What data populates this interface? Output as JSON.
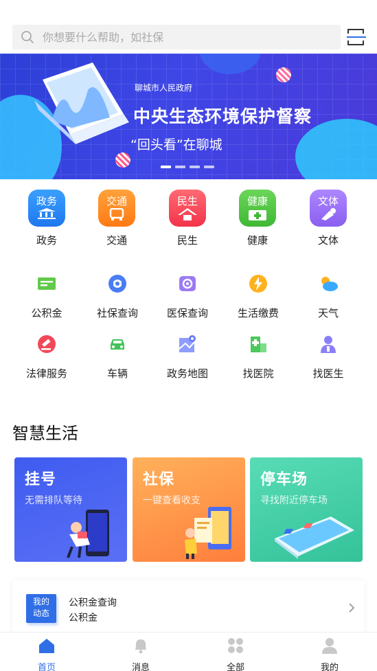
{
  "search": {
    "placeholder": "你想要什么帮助，如社保"
  },
  "banner": {
    "org": "聊城市人民政府",
    "title": "中央生态环境保护督察",
    "subtitle": "“回头看”在聊城",
    "active_dot": 1,
    "dot_count": 4
  },
  "categories": [
    {
      "label": "政务",
      "icon_text": "政务",
      "icon": "government-building-icon",
      "color": "#2d8df5"
    },
    {
      "label": "交通",
      "icon_text": "交通",
      "icon": "bus-icon",
      "color": "#ff8a1f"
    },
    {
      "label": "民生",
      "icon_text": "民生",
      "icon": "house-icon",
      "color": "#f5475a"
    },
    {
      "label": "健康",
      "icon_text": "健康",
      "icon": "medical-kit-icon",
      "color": "#56c94a"
    },
    {
      "label": "文体",
      "icon_text": "文体",
      "icon": "sports-icon",
      "color": "#9b6ff4"
    }
  ],
  "services_row1": [
    {
      "label": "公积金",
      "icon": "fund-card-icon"
    },
    {
      "label": "社保查询",
      "icon": "social-security-icon"
    },
    {
      "label": "医保查询",
      "icon": "medical-insurance-icon"
    },
    {
      "label": "生活缴费",
      "icon": "utility-payment-icon"
    },
    {
      "label": "天气",
      "icon": "weather-icon"
    }
  ],
  "services_row2": [
    {
      "label": "法律服务",
      "icon": "gavel-icon"
    },
    {
      "label": "车辆",
      "icon": "car-icon"
    },
    {
      "label": "政务地图",
      "icon": "map-icon"
    },
    {
      "label": "找医院",
      "icon": "hospital-icon"
    },
    {
      "label": "找医生",
      "icon": "doctor-icon"
    }
  ],
  "smart_life": {
    "title": "智慧生活",
    "cards": [
      {
        "title": "挂号",
        "subtitle": "无需排队等待",
        "color_from": "#3f5cf0",
        "color_to": "#5a6ff5"
      },
      {
        "title": "社保",
        "subtitle": "一键查看收支",
        "color_from": "#ffb15a",
        "color_to": "#ff7e3c"
      },
      {
        "title": "停车场",
        "subtitle": "寻找附近停车场",
        "color_from": "#4fd6b0",
        "color_to": "#37c49a"
      }
    ]
  },
  "news": {
    "badge_line1": "我的",
    "badge_line2": "动态",
    "line1": "公积金查询",
    "line2": "公积金"
  },
  "tabbar": [
    {
      "label": "首页",
      "icon": "home-icon",
      "active": true
    },
    {
      "label": "消息",
      "icon": "bell-icon",
      "active": false
    },
    {
      "label": "全部",
      "icon": "grid-icon",
      "active": false
    },
    {
      "label": "我的",
      "icon": "user-icon",
      "active": false
    }
  ],
  "colors": {
    "accent": "#2f6ee6"
  }
}
